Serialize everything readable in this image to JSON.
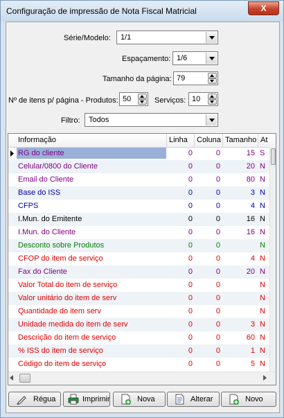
{
  "window": {
    "title": "Configuração de impressão de Nota Fiscal Matricial",
    "close_label": "X"
  },
  "form": {
    "serie_label": "Série/Modelo:",
    "serie_value": "1/1",
    "espacamento_label": "Espaçamento:",
    "espacamento_value": "1/6",
    "tamanho_label": "Tamanho da página:",
    "tamanho_value": "79",
    "itens_label": "Nº de itens p/ página - Produtos:",
    "itens_produtos_value": "50",
    "servicos_label": "Serviços:",
    "servicos_value": "10",
    "filtro_label": "Filtro:",
    "filtro_value": "Todos"
  },
  "grid": {
    "headers": {
      "informacao": "Informação",
      "linha": "Linha",
      "coluna": "Coluna",
      "tamanho": "Tamanho",
      "at": "At"
    },
    "rows": [
      {
        "name": "RG do cliente",
        "linha": "0",
        "coluna": "0",
        "tamanho": "15",
        "at": "S",
        "color": "#800080"
      },
      {
        "name": "Celular/0800 do Cliente",
        "linha": "0",
        "coluna": "0",
        "tamanho": "20",
        "at": "N",
        "color": "#800080"
      },
      {
        "name": "Email do Cliente",
        "linha": "0",
        "coluna": "0",
        "tamanho": "80",
        "at": "N",
        "color": "#800080"
      },
      {
        "name": "Base do ISS",
        "linha": "0",
        "coluna": "0",
        "tamanho": "3",
        "at": "N",
        "color": "#0000b0"
      },
      {
        "name": "CFPS",
        "linha": "0",
        "coluna": "0",
        "tamanho": "4",
        "at": "N",
        "color": "#0000b0"
      },
      {
        "name": "I.Mun. do Emitente",
        "linha": "0",
        "coluna": "0",
        "tamanho": "16",
        "at": "N",
        "color": "#000000"
      },
      {
        "name": "I.Mun. do Cliente",
        "linha": "0",
        "coluna": "0",
        "tamanho": "16",
        "at": "N",
        "color": "#800080"
      },
      {
        "name": "Desconto sobre Produtos",
        "linha": "0",
        "coluna": "0",
        "tamanho": "",
        "at": "N",
        "color": "#008000"
      },
      {
        "name": "CFOP do item de serviço",
        "linha": "0",
        "coluna": "0",
        "tamanho": "4",
        "at": "N",
        "color": "#e00000"
      },
      {
        "name": "Fax do Cliente",
        "linha": "0",
        "coluna": "0",
        "tamanho": "20",
        "at": "N",
        "color": "#800080"
      },
      {
        "name": "Valor Total do item de serviço",
        "linha": "0",
        "coluna": "0",
        "tamanho": "",
        "at": "N",
        "color": "#e00000"
      },
      {
        "name": "Valor unitário do item de serv",
        "linha": "0",
        "coluna": "0",
        "tamanho": "",
        "at": "N",
        "color": "#e00000"
      },
      {
        "name": "Quantidade do item serv",
        "linha": "0",
        "coluna": "0",
        "tamanho": "",
        "at": "N",
        "color": "#e00000"
      },
      {
        "name": "Unidade medida do item de serv",
        "linha": "0",
        "coluna": "0",
        "tamanho": "3",
        "at": "N",
        "color": "#e00000"
      },
      {
        "name": "Descrição do item de serviço",
        "linha": "0",
        "coluna": "0",
        "tamanho": "60",
        "at": "N",
        "color": "#e00000"
      },
      {
        "name": "% ISS do item de serviço",
        "linha": "0",
        "coluna": "0",
        "tamanho": "1",
        "at": "N",
        "color": "#e00000"
      },
      {
        "name": "Código do item de serviço",
        "linha": "0",
        "coluna": "0",
        "tamanho": "5",
        "at": "N",
        "color": "#e00000"
      }
    ],
    "selected_index": 0,
    "selected_bg": "#9ab0d8"
  },
  "buttons": {
    "regua": "Régua",
    "imprimir": "Imprimir",
    "nova": "Nova",
    "alterar": "Alterar",
    "novo": "Novo"
  }
}
